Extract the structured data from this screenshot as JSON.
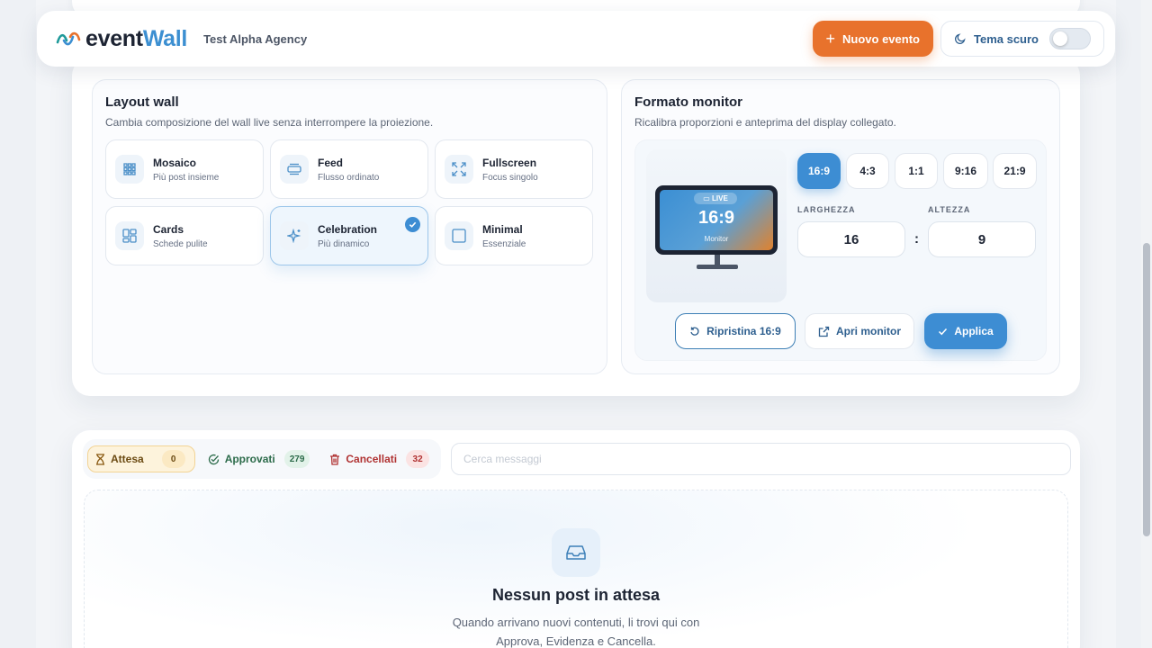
{
  "header": {
    "logo_part1": "event",
    "logo_part2": "Wall",
    "agency": "Test Alpha Agency",
    "new_event_label": "Nuovo evento",
    "theme_label": "Tema scuro",
    "theme_dark_enabled": false
  },
  "layout": {
    "title": "Layout wall",
    "subtitle": "Cambia composizione del wall live senza interrompere la proiezione.",
    "options": [
      {
        "name": "Mosaico",
        "desc": "Più post insieme",
        "icon": "grid-icon",
        "selected": false
      },
      {
        "name": "Feed",
        "desc": "Flusso ordinato",
        "icon": "feed-icon",
        "selected": false
      },
      {
        "name": "Fullscreen",
        "desc": "Focus singolo",
        "icon": "expand-icon",
        "selected": false
      },
      {
        "name": "Cards",
        "desc": "Schede pulite",
        "icon": "cards-icon",
        "selected": false
      },
      {
        "name": "Celebration",
        "desc": "Più dinamico",
        "icon": "sparkle-icon",
        "selected": true
      },
      {
        "name": "Minimal",
        "desc": "Essenziale",
        "icon": "square-icon",
        "selected": false
      }
    ]
  },
  "monitor": {
    "title": "Formato monitor",
    "subtitle": "Ricalibra proporzioni e anteprima del display collegato.",
    "preview_live": "LIVE",
    "preview_ratio": "16:9",
    "preview_label": "Monitor",
    "ratios": [
      "16:9",
      "4:3",
      "1:1",
      "9:16",
      "21:9"
    ],
    "selected_ratio": "16:9",
    "width_label": "LARGHEZZA",
    "height_label": "ALTEZZA",
    "width_value": "16",
    "height_value": "9",
    "separator": ":",
    "reset_label": "Ripristina 16:9",
    "open_label": "Apri monitor",
    "apply_label": "Applica"
  },
  "moderation": {
    "tabs": {
      "wait_label": "Attesa",
      "wait_count": "0",
      "approved_label": "Approvati",
      "approved_count": "279",
      "deleted_label": "Cancellati",
      "deleted_count": "32"
    },
    "search_placeholder": "Cerca messaggi",
    "empty_title": "Nessun post in attesa",
    "empty_line1": "Quando arrivano nuovi contenuti, li trovi qui con",
    "empty_line2": "Approva, Evidenza e Cancella."
  },
  "colors": {
    "accent": "#3d8dd3",
    "brand_orange": "#e8722c",
    "wait": "#f2d394",
    "approved": "#2c6b4a",
    "deleted": "#b03232"
  }
}
